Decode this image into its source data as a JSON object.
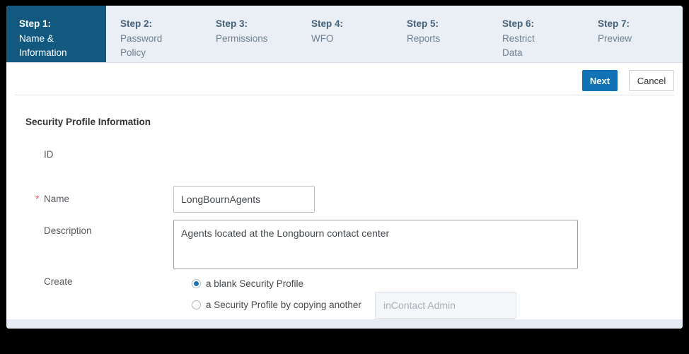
{
  "steps": [
    {
      "num": "Step 1:",
      "label": "Name &\nInformation",
      "active": true
    },
    {
      "num": "Step 2:",
      "label": "Password\nPolicy",
      "active": false
    },
    {
      "num": "Step 3:",
      "label": "Permissions",
      "active": false
    },
    {
      "num": "Step 4:",
      "label": "WFO",
      "active": false
    },
    {
      "num": "Step 5:",
      "label": "Reports",
      "active": false
    },
    {
      "num": "Step 6:",
      "label": "Restrict\nData",
      "active": false
    },
    {
      "num": "Step 7:",
      "label": "Preview",
      "active": false
    }
  ],
  "actions": {
    "next_label": "Next",
    "cancel_label": "Cancel"
  },
  "form": {
    "section_title": "Security Profile Information",
    "id_label": "ID",
    "id_value": "",
    "name_label": "Name",
    "name_required_marker": "*",
    "name_value": "LongBournAgents",
    "name_placeholder": "",
    "description_label": "Description",
    "description_value": "Agents located at the Longbourn contact center",
    "description_placeholder": "",
    "create_label": "Create",
    "create_options": [
      {
        "text": "a blank Security Profile",
        "selected": true
      },
      {
        "text": "a Security Profile by copying another",
        "selected": false
      }
    ],
    "copy_source_value": "inContact Admin"
  },
  "colors": {
    "active_tab_bg": "#12597f",
    "tabbar_bg": "#eaeff5",
    "primary_button": "#1272b6",
    "radio_selected": "#1b73ba",
    "required_star": "#e8584e",
    "bottom_strip": "#e4ebf4"
  }
}
